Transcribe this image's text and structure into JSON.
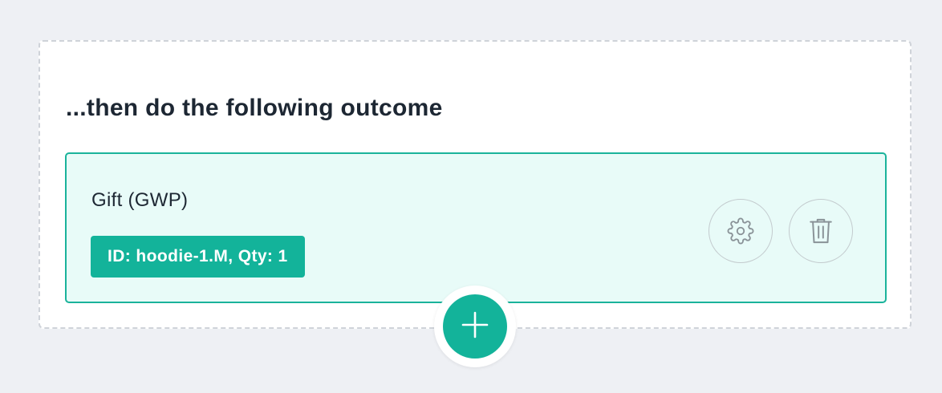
{
  "panel": {
    "heading": "...then do the following outcome"
  },
  "outcome": {
    "title": "Gift (GWP)",
    "tag": "ID: hoodie-1.M, Qty: 1"
  },
  "icons": {
    "settings": "gear-icon",
    "delete": "trash-icon",
    "add": "plus-icon"
  },
  "colors": {
    "accent": "#13b39a",
    "card_background": "#e8fbf8",
    "card_border": "#1ab39b",
    "page_background": "#eef0f4",
    "text": "#1d2733"
  }
}
